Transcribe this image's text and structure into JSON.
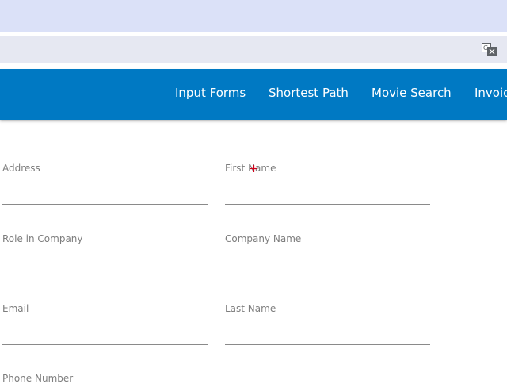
{
  "nav": {
    "links": [
      "Input Forms",
      "Shortest Path",
      "Movie Search",
      "Invoices"
    ]
  },
  "icons": {
    "translate": "translate-icon"
  },
  "form": {
    "address": {
      "label": "Address",
      "value": ""
    },
    "first_name": {
      "label": "First Name",
      "value": ""
    },
    "role": {
      "label": "Role in Company",
      "value": ""
    },
    "company": {
      "label": "Company Name",
      "value": ""
    },
    "email": {
      "label": "Email",
      "value": ""
    },
    "last_name": {
      "label": "Last Name",
      "value": ""
    },
    "phone": {
      "label": "Phone Number",
      "value": ""
    }
  },
  "colors": {
    "nav_bg": "#0079c3",
    "label": "#7d7d7d",
    "underline": "#8a8a8a"
  }
}
